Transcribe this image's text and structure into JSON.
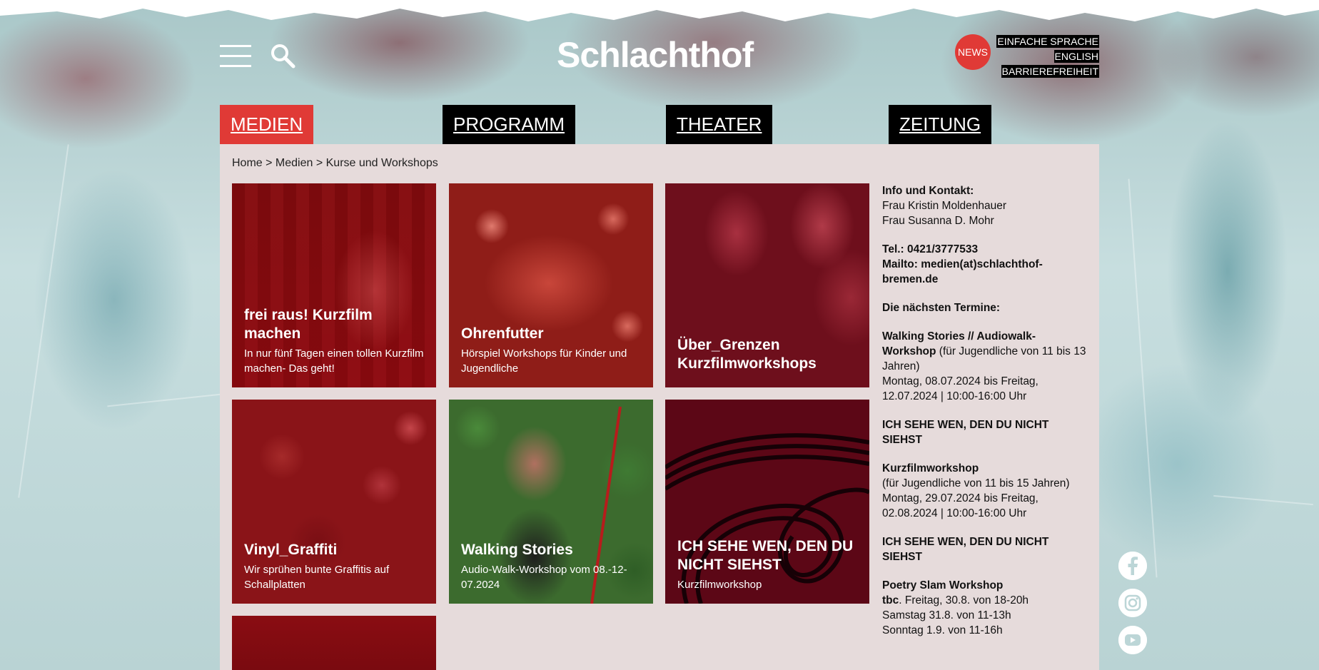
{
  "header": {
    "logo": "Schlachthof",
    "news_label": "NEWS",
    "links": [
      "EINFACHE SPRACHE",
      "ENGLISH",
      "BARRIEREFREIHEIT"
    ]
  },
  "nav": {
    "tabs": [
      {
        "label": "MEDIEN",
        "active": true
      },
      {
        "label": "PROGRAMM",
        "active": false
      },
      {
        "label": "THEATER",
        "active": false
      },
      {
        "label": "ZEITUNG",
        "active": false
      }
    ]
  },
  "breadcrumb": "Home > Medien > Kurse und Workshops",
  "cards": [
    {
      "title": "frei raus! Kurzfilm machen",
      "subtitle": "In nur fünf Tagen einen tollen Kurzfilm machen- Das geht!"
    },
    {
      "title": "Ohrenfutter",
      "subtitle": "Hörspiel Workshops für Kinder und Jugendliche"
    },
    {
      "title": "Über_Grenzen Kurzfilmworkshops",
      "subtitle": ""
    },
    {
      "title": "Vinyl_Graffiti",
      "subtitle": "Wir sprühen bunte Graffitis auf Schallplatten"
    },
    {
      "title": "Walking Stories",
      "subtitle": "Audio-Walk-Workshop vom 08.-12-07.2024"
    },
    {
      "title": "ICH SEHE WEN, DEN DU NICHT SIEHST",
      "subtitle": "Kurzfilmworkshop"
    }
  ],
  "sidebar": {
    "info_heading": "Info und Kontakt:",
    "contact1": "Frau Kristin Moldenhauer",
    "contact2": "Frau Susanna D. Mohr",
    "tel": "Tel.: 0421/3777533",
    "mail": "Mailto: medien(at)schlachthof-bremen.de",
    "dates_heading": "Die nächsten Termine:",
    "event1_title": "Walking Stories // Audiowalk-Workshop",
    "event1_note": " (für Jugendliche von 11 bis 13 Jahren)",
    "event1_date": "Montag, 08.07.2024 bis Freitag, 12.07.2024 | 10:00-16:00 Uhr",
    "event2_title": "ICH SEHE WEN, DEN DU NICHT SIEHST",
    "event3_title": "Kurzfilmworkshop",
    "event3_note": "(für Jugendliche von 11 bis 15 Jahren)",
    "event3_date": "Montag, 29.07.2024 bis Freitag, 02.08.2024 | 10:00-16:00 Uhr",
    "event4_title": "ICH SEHE WEN, DEN DU NICHT SIEHST",
    "event5_title": "Poetry Slam Workshop",
    "event5_tbc": "tbc",
    "event5_line1": ". Freitag, 30.8. von 18-20h",
    "event5_line2": "Samstag 31.8. von 11-13h",
    "event5_line3": "Sonntag 1.9. von 11-16h"
  },
  "social": [
    "facebook-icon",
    "instagram-icon",
    "youtube-icon"
  ]
}
